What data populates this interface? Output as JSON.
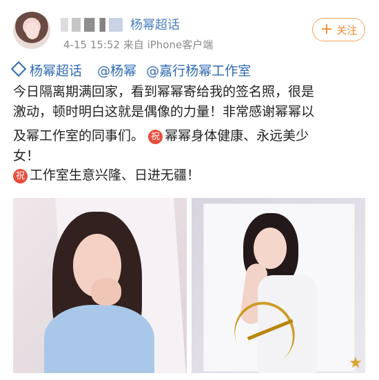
{
  "post": {
    "topic_name": "杨幂超话",
    "meta": "4-15 15:52  来自 iPhone客户端",
    "follow_label": "关注",
    "mentions": [
      "杨幂超话",
      "@杨幂",
      "@嘉行杨幂工作室"
    ],
    "text_lines": [
      "今日隔离期满回家，看到幂幂寄给我的签名照，很是",
      "激动，顿时明白这就是偶像的力量！非常感谢幂幂以",
      "及幂工作室的同事们。",
      "幂幂身体健康、永远美少",
      "女！",
      "工作室生意兴隆、日进无疆！"
    ],
    "badge_label": "祝"
  }
}
